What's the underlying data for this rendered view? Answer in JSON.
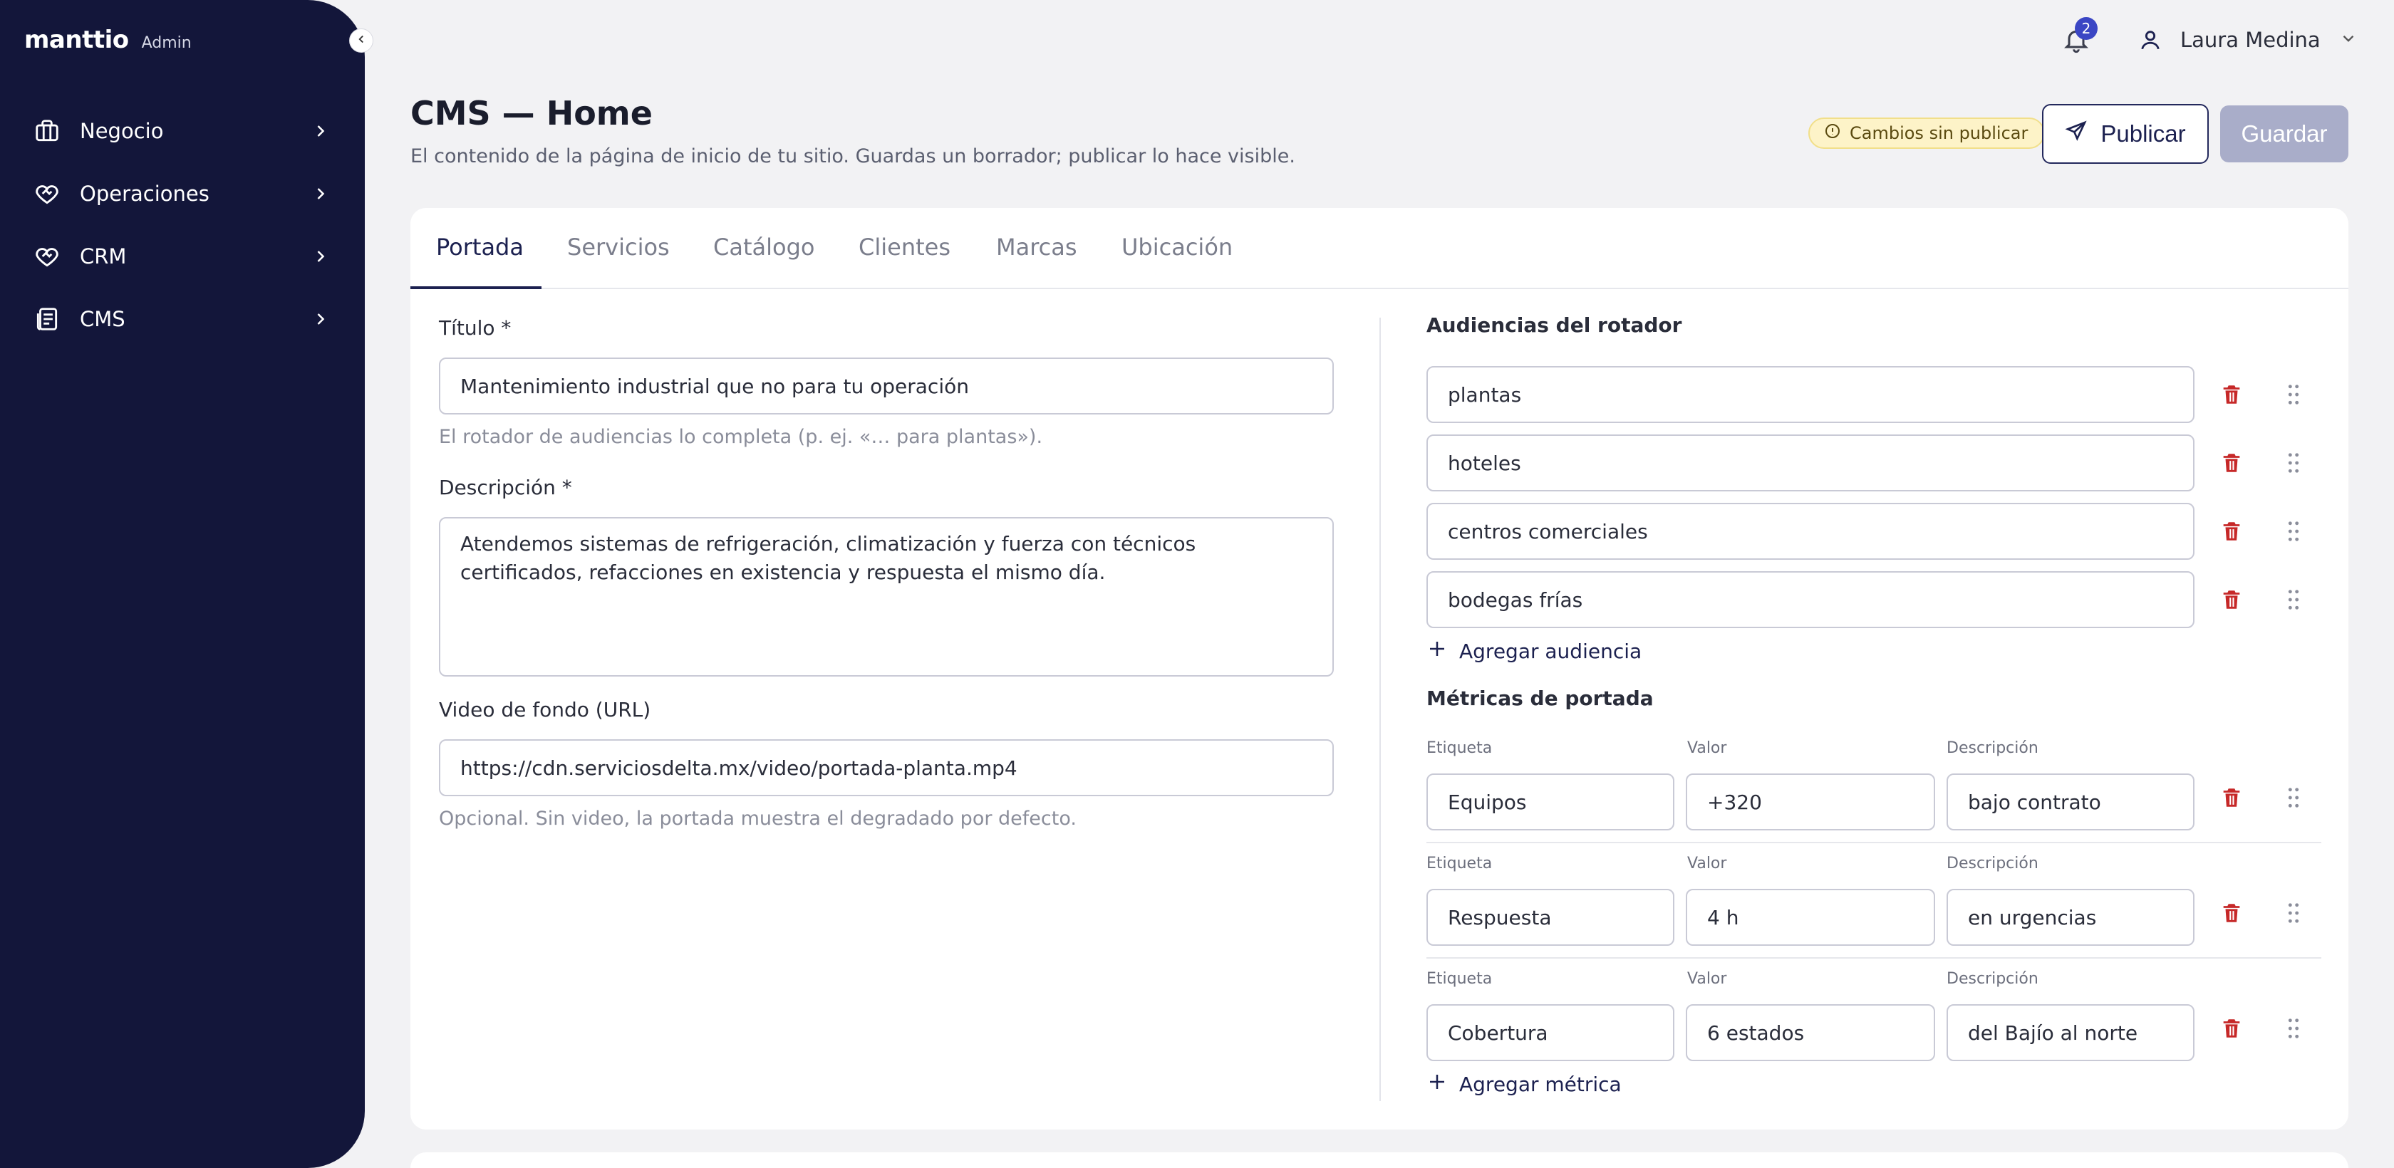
{
  "brand": {
    "name": "manttio",
    "badge": "Admin"
  },
  "sidebar": {
    "items": [
      {
        "label": "Negocio",
        "icon": "building-icon"
      },
      {
        "label": "Operaciones",
        "icon": "heart-handshake-icon"
      },
      {
        "label": "CRM",
        "icon": "heart-handshake-icon"
      },
      {
        "label": "CMS",
        "icon": "cms-pages-icon"
      }
    ]
  },
  "topbar": {
    "notifications": "2",
    "user_name": "Laura Medina"
  },
  "header": {
    "title": "CMS — Home",
    "subtitle": "El contenido de la página de inicio de tu sitio. Guardas un borrador; publicar lo hace visible.",
    "unsaved_badge": "Cambios sin publicar",
    "publish_label": "Publicar",
    "save_label": "Guardar"
  },
  "tabs": [
    "Portada",
    "Servicios",
    "Catálogo",
    "Clientes",
    "Marcas",
    "Ubicación"
  ],
  "form": {
    "title_label": "Título *",
    "title_value": "Mantenimiento industrial que no para tu operación",
    "title_hint": "El rotador de audiencias lo completa (p. ej. «… para plantas»).",
    "desc_label": "Descripción *",
    "desc_value": "Atendemos sistemas de refrigeración, climatización y fuerza con técnicos certificados, refacciones en existencia y respuesta el mismo día.",
    "video_label": "Video de fondo (URL)",
    "video_value": "https://cdn.serviciosdelta.mx/video/portada-planta.mp4",
    "video_hint": "Opcional. Sin video, la portada muestra el degradado por defecto."
  },
  "audiences": {
    "title": "Audiencias del rotador",
    "items": [
      "plantas",
      "hoteles",
      "centros comerciales",
      "bodegas frías"
    ],
    "add_label": "Agregar audiencia"
  },
  "metrics": {
    "title": "Métricas de portada",
    "col_label": "Etiqueta",
    "col_value": "Valor",
    "col_desc": "Descripción",
    "rows": [
      {
        "label": "Equipos",
        "value": "+320",
        "desc": "bajo contrato"
      },
      {
        "label": "Respuesta",
        "value": "4 h",
        "desc": "en urgencias"
      },
      {
        "label": "Cobertura",
        "value": "6 estados",
        "desc": "del Bajío al norte"
      }
    ],
    "add_label": "Agregar métrica"
  },
  "colors": {
    "sidebar": "#13163a",
    "accent": "#1c2150",
    "danger": "#c62828",
    "badge": "#fdf3c8"
  }
}
